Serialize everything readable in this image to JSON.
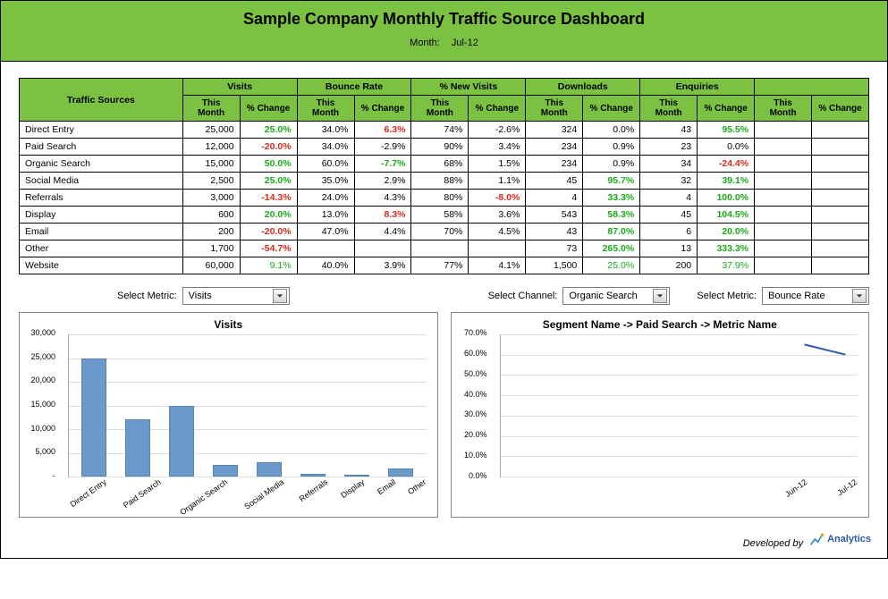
{
  "header": {
    "title": "Sample Company Monthly Traffic Source Dashboard",
    "month_label": "Month:",
    "month_value": "Jul-12"
  },
  "table": {
    "col_traffic_sources": "Traffic Sources",
    "groups": [
      "Visits",
      "Bounce Rate",
      "% New Visits",
      "Downloads",
      "Enquiries",
      ""
    ],
    "sub_this_month": "This Month",
    "sub_change": "% Change",
    "rows": [
      {
        "src": "Direct Entry",
        "visits_tm": "25,000",
        "visits_ch": "25.0%",
        "visits_sign": "pos",
        "br_tm": "34.0%",
        "br_ch": "6.3%",
        "br_sign": "neg",
        "nv_tm": "74%",
        "nv_ch": "-2.6%",
        "nv_sign": "",
        "dl_tm": "324",
        "dl_ch": "0.0%",
        "dl_sign": "",
        "en_tm": "43",
        "en_ch": "95.5%",
        "en_sign": "pos"
      },
      {
        "src": "Paid Search",
        "visits_tm": "12,000",
        "visits_ch": "-20.0%",
        "visits_sign": "neg",
        "br_tm": "34.0%",
        "br_ch": "-2.9%",
        "br_sign": "",
        "nv_tm": "90%",
        "nv_ch": "3.4%",
        "nv_sign": "",
        "dl_tm": "234",
        "dl_ch": "0.9%",
        "dl_sign": "",
        "en_tm": "23",
        "en_ch": "0.0%",
        "en_sign": ""
      },
      {
        "src": "Organic Search",
        "visits_tm": "15,000",
        "visits_ch": "50.0%",
        "visits_sign": "pos",
        "br_tm": "60.0%",
        "br_ch": "-7.7%",
        "br_sign": "pos",
        "nv_tm": "68%",
        "nv_ch": "1.5%",
        "nv_sign": "",
        "dl_tm": "234",
        "dl_ch": "0.9%",
        "dl_sign": "",
        "en_tm": "34",
        "en_ch": "-24.4%",
        "en_sign": "neg"
      },
      {
        "src": "Social Media",
        "visits_tm": "2,500",
        "visits_ch": "25.0%",
        "visits_sign": "pos",
        "br_tm": "35.0%",
        "br_ch": "2.9%",
        "br_sign": "",
        "nv_tm": "88%",
        "nv_ch": "1.1%",
        "nv_sign": "",
        "dl_tm": "45",
        "dl_ch": "95.7%",
        "dl_sign": "pos",
        "en_tm": "32",
        "en_ch": "39.1%",
        "en_sign": "pos"
      },
      {
        "src": "Referrals",
        "visits_tm": "3,000",
        "visits_ch": "-14.3%",
        "visits_sign": "neg",
        "br_tm": "24.0%",
        "br_ch": "4.3%",
        "br_sign": "",
        "nv_tm": "80%",
        "nv_ch": "-8.0%",
        "nv_sign": "neg",
        "dl_tm": "4",
        "dl_ch": "33.3%",
        "dl_sign": "pos",
        "en_tm": "4",
        "en_ch": "100.0%",
        "en_sign": "pos"
      },
      {
        "src": "Display",
        "visits_tm": "600",
        "visits_ch": "20.0%",
        "visits_sign": "pos",
        "br_tm": "13.0%",
        "br_ch": "8.3%",
        "br_sign": "neg",
        "nv_tm": "58%",
        "nv_ch": "3.6%",
        "nv_sign": "",
        "dl_tm": "543",
        "dl_ch": "58.3%",
        "dl_sign": "pos",
        "en_tm": "45",
        "en_ch": "104.5%",
        "en_sign": "pos"
      },
      {
        "src": "Email",
        "visits_tm": "200",
        "visits_ch": "-20.0%",
        "visits_sign": "neg",
        "br_tm": "47.0%",
        "br_ch": "4.4%",
        "br_sign": "",
        "nv_tm": "70%",
        "nv_ch": "4.5%",
        "nv_sign": "",
        "dl_tm": "43",
        "dl_ch": "87.0%",
        "dl_sign": "pos",
        "en_tm": "6",
        "en_ch": "20.0%",
        "en_sign": "pos"
      },
      {
        "src": "Other",
        "visits_tm": "1,700",
        "visits_ch": "-54.7%",
        "visits_sign": "neg",
        "br_tm": "",
        "br_ch": "",
        "br_sign": "",
        "nv_tm": "",
        "nv_ch": "",
        "nv_sign": "",
        "dl_tm": "73",
        "dl_ch": "265.0%",
        "dl_sign": "pos",
        "en_tm": "13",
        "en_ch": "333.3%",
        "en_sign": "pos"
      }
    ],
    "total": {
      "src": "Website",
      "visits_tm": "60,000",
      "visits_ch": "9.1%",
      "visits_sign": "pos",
      "br_tm": "40.0%",
      "br_ch": "3.9%",
      "br_sign": "",
      "nv_tm": "77%",
      "nv_ch": "4.1%",
      "nv_sign": "",
      "dl_tm": "1,500",
      "dl_ch": "25.0%",
      "dl_sign": "pos",
      "en_tm": "200",
      "en_ch": "37.9%",
      "en_sign": "pos"
    }
  },
  "controls": {
    "select_metric_label": "Select Metric:",
    "metric_value_left": "Visits",
    "select_channel_label": "Select Channel:",
    "channel_value": "Organic Search",
    "metric_value_right": "Bounce Rate"
  },
  "chart_left_title": "Visits",
  "chart_right_title": "Segment Name -> Paid Search -> Metric Name",
  "footer": {
    "developed_by": "Developed by",
    "brand": "Analytics"
  },
  "chart_data": [
    {
      "type": "bar",
      "title": "Visits",
      "categories": [
        "Direct Entry",
        "Paid Search",
        "Organic Search",
        "Social Media",
        "Referrals",
        "Display",
        "Email",
        "Other"
      ],
      "values": [
        25000,
        12000,
        15000,
        2500,
        3000,
        600,
        200,
        1700
      ],
      "ylim": [
        0,
        30000
      ],
      "yticks": [
        0,
        5000,
        10000,
        15000,
        20000,
        25000,
        30000
      ],
      "ytick_labels": [
        "-",
        "5,000",
        "10,000",
        "15,000",
        "20,000",
        "25,000",
        "30,000"
      ]
    },
    {
      "type": "line",
      "title": "Segment Name -> Paid Search -> Metric Name",
      "x": [
        "Jun-12",
        "Jul-12"
      ],
      "values": [
        65.0,
        60.0
      ],
      "ylim": [
        0,
        70
      ],
      "yticks": [
        0,
        10,
        20,
        30,
        40,
        50,
        60,
        70
      ],
      "ytick_labels": [
        "0.0%",
        "10.0%",
        "20.0%",
        "30.0%",
        "40.0%",
        "50.0%",
        "60.0%",
        "70.0%"
      ]
    }
  ]
}
